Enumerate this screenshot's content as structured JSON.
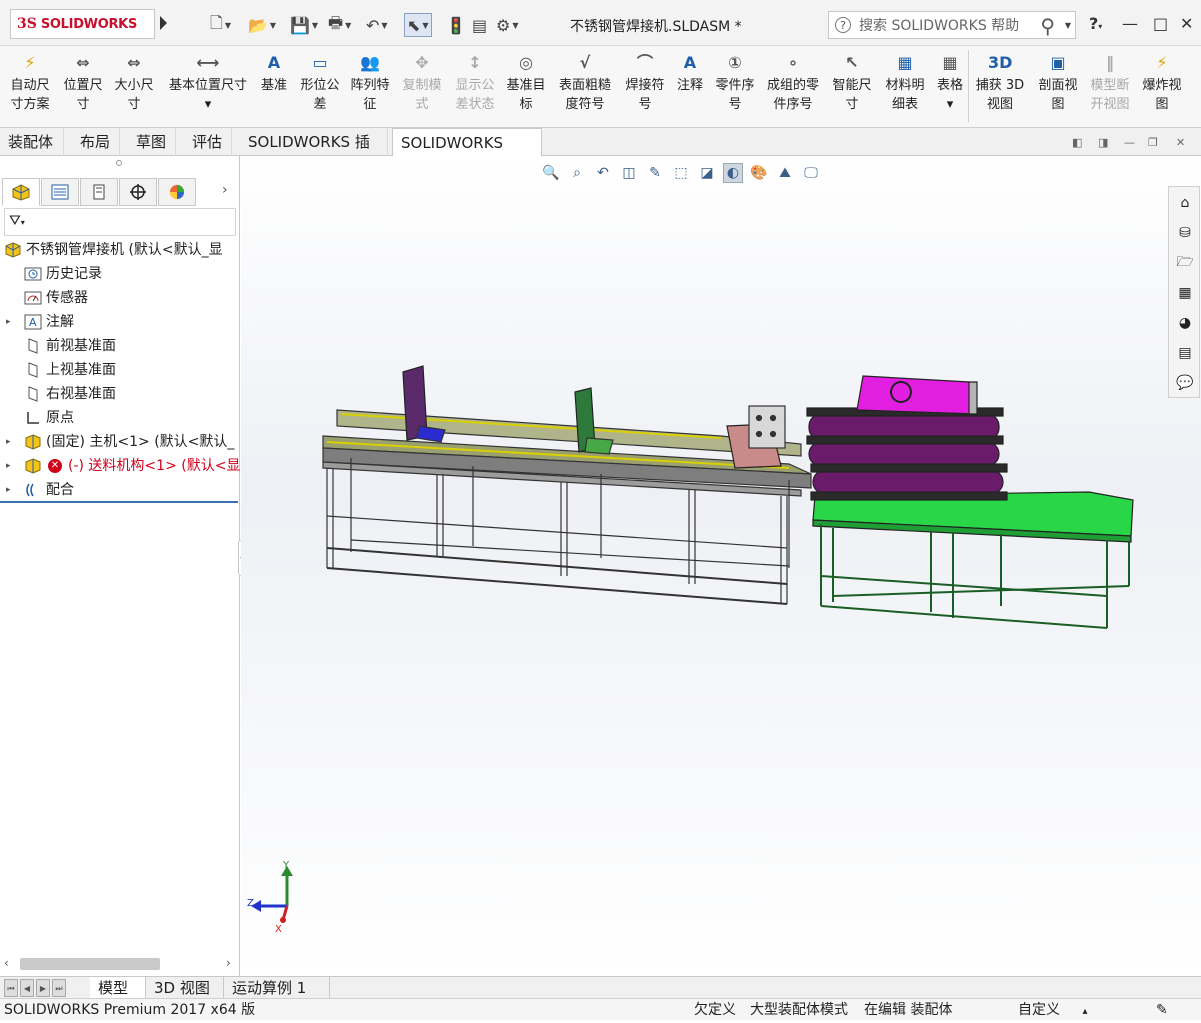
{
  "app": {
    "logo_mark": "3S",
    "logo_text": "SOLIDWORKS",
    "document_title": "不锈钢管焊接机.SLDASM *",
    "search_placeholder": "搜索 SOLIDWORKS 帮助",
    "help_label": "?",
    "help_dd": "▾",
    "minimize": "—",
    "maximize": "□",
    "close": "✕"
  },
  "quick_access": [
    {
      "name": "new-document-icon",
      "glyph": "🗋"
    },
    {
      "name": "open-icon",
      "glyph": "📂"
    },
    {
      "name": "save-icon",
      "glyph": "💾"
    },
    {
      "name": "print-icon",
      "glyph": "🖶"
    },
    {
      "name": "undo-icon",
      "glyph": "↶"
    },
    {
      "name": "select-cursor-icon",
      "glyph": "⬉"
    },
    {
      "name": "rebuild-icon",
      "glyph": "🚦"
    },
    {
      "name": "file-properties-icon",
      "glyph": "▤"
    },
    {
      "name": "options-icon",
      "glyph": "⚙"
    }
  ],
  "ribbon": {
    "commands": [
      {
        "id": "auto-dimension",
        "label1": "自动尺",
        "label2": "寸方案",
        "enabled": true,
        "color": "#e0a000"
      },
      {
        "id": "location-dimension",
        "label1": "位置尺",
        "label2": "寸",
        "enabled": true,
        "color": "#555"
      },
      {
        "id": "size-dimension",
        "label1": "大小尺",
        "label2": "寸",
        "enabled": true,
        "color": "#555"
      },
      {
        "id": "basic-location-dimension",
        "label1": "基本位置尺寸",
        "label2": "▾",
        "enabled": true,
        "color": "#555"
      },
      {
        "id": "datum",
        "label1": "基准",
        "label2": "",
        "enabled": true,
        "color": "#1f5fa8"
      },
      {
        "id": "geometric-tolerance",
        "label1": "形位公",
        "label2": "差",
        "enabled": true,
        "color": "#1f5fa8"
      },
      {
        "id": "pattern-feature",
        "label1": "阵列特",
        "label2": "征",
        "enabled": true,
        "color": "#1f5fa8"
      },
      {
        "id": "copy-scheme",
        "label1": "复制模",
        "label2": "式",
        "enabled": false,
        "color": "#aaa"
      },
      {
        "id": "show-tolerance-status",
        "label1": "显示公",
        "label2": "差状态",
        "enabled": false,
        "color": "#aaa"
      },
      {
        "id": "datum-target",
        "label1": "基准目",
        "label2": "标",
        "enabled": true,
        "color": "#555"
      },
      {
        "id": "surface-finish",
        "label1": "表面粗糙",
        "label2": "度符号",
        "enabled": true,
        "color": "#555"
      },
      {
        "id": "weld-symbol",
        "label1": "焊接符",
        "label2": "号",
        "enabled": true,
        "color": "#555"
      },
      {
        "id": "note",
        "label1": "注释",
        "label2": "",
        "enabled": true,
        "color": "#1f5fa8"
      },
      {
        "id": "balloon",
        "label1": "零件序",
        "label2": "号",
        "enabled": true,
        "color": "#555"
      },
      {
        "id": "stacked-balloon",
        "label1": "成组的零",
        "label2": "件序号",
        "enabled": true,
        "color": "#555"
      },
      {
        "id": "smart-dimension",
        "label1": "智能尺",
        "label2": "寸",
        "enabled": true,
        "color": "#555"
      },
      {
        "id": "bill-of-materials",
        "label1": "材料明",
        "label2": "细表",
        "enabled": true,
        "color": "#1f5fa8"
      },
      {
        "id": "table",
        "label1": "表格",
        "label2": "▾",
        "enabled": true,
        "color": "#555"
      },
      {
        "id": "capture-3d-view",
        "label1": "捕获 3D",
        "label2": "视图",
        "enabled": true,
        "color": "#1f5fa8"
      },
      {
        "id": "section-view",
        "label1": "剖面视",
        "label2": "图",
        "enabled": true,
        "color": "#1f5fa8"
      },
      {
        "id": "model-break-view",
        "label1": "模型断",
        "label2": "开视图",
        "enabled": false,
        "color": "#aaa"
      },
      {
        "id": "exploded-view",
        "label1": "爆炸视",
        "label2": "图",
        "enabled": true,
        "color": "#e0a000"
      }
    ]
  },
  "tabs": [
    "装配体",
    "布局",
    "草图",
    "评估",
    "SOLIDWORKS 插件",
    "SOLIDWORKS MBD"
  ],
  "active_tab": "SOLIDWORKS MBD",
  "tree": [
    {
      "label": "不锈钢管焊接机  (默认<默认_显",
      "indent": 0,
      "expand": "",
      "icon": "assembly",
      "red": false
    },
    {
      "label": "历史记录",
      "indent": 1,
      "expand": "",
      "icon": "history",
      "red": false
    },
    {
      "label": "传感器",
      "indent": 1,
      "expand": "",
      "icon": "sensor",
      "red": false
    },
    {
      "label": "注解",
      "indent": 1,
      "expand": "▸",
      "icon": "annotation",
      "red": false
    },
    {
      "label": "前视基准面",
      "indent": 1,
      "expand": "",
      "icon": "plane",
      "red": false
    },
    {
      "label": "上视基准面",
      "indent": 1,
      "expand": "",
      "icon": "plane",
      "red": false
    },
    {
      "label": "右视基准面",
      "indent": 1,
      "expand": "",
      "icon": "plane",
      "red": false
    },
    {
      "label": "原点",
      "indent": 1,
      "expand": "",
      "icon": "origin",
      "red": false
    },
    {
      "label": "(固定) 主机<1> (默认<默认_",
      "indent": 1,
      "expand": "▸",
      "icon": "part",
      "red": false
    },
    {
      "label": "(-) 送料机构<1> (默认<显",
      "indent": 1,
      "expand": "▸",
      "icon": "part-error",
      "red": true
    },
    {
      "label": "配合",
      "indent": 1,
      "expand": "▸",
      "icon": "mates",
      "red": false
    }
  ],
  "bottom_tabs": [
    "模型",
    "3D 视图",
    "运动算例 1"
  ],
  "active_bottom_tab": "模型",
  "status": {
    "product": "SOLIDWORKS Premium 2017 x64 版",
    "definition": "欠定义",
    "mode": "大型装配体模式",
    "editing": "在编辑 装配体",
    "custom": "自定义",
    "custom_dd": "▴"
  },
  "triad": {
    "x": "X",
    "y": "Y",
    "z": "Z"
  }
}
